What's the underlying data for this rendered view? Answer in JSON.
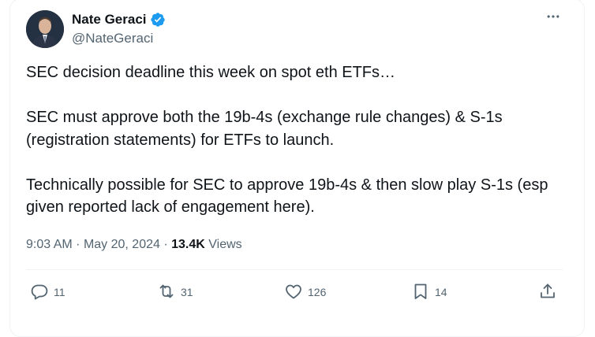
{
  "author": {
    "name": "Nate Geraci",
    "handle": "@NateGeraci"
  },
  "tweet": {
    "text": "SEC decision deadline this week on spot eth ETFs…\n\nSEC must approve both the 19b-4s (exchange rule changes) & S-1s (registration statements) for ETFs to launch.\n\nTechnically possible for SEC to approve 19b-4s & then slow play S-1s (esp given reported lack of engagement here).",
    "time": "9:03 AM",
    "separator": "·",
    "date": "May 20, 2024",
    "views_count": "13.4K",
    "views_label": "Views"
  },
  "actions": {
    "replies": "11",
    "reposts": "31",
    "likes": "126",
    "bookmarks": "14"
  },
  "icons": {
    "more": "more-horizontal-icon",
    "verified": "verified-badge-icon",
    "reply": "reply-bubble-icon",
    "repost": "repost-icon",
    "like": "heart-icon",
    "bookmark": "bookmark-icon",
    "share": "share-upload-icon"
  },
  "colors": {
    "verified": "#1d9bf0",
    "text": "#0f1419",
    "secondary": "#536471",
    "border": "#eff3f4"
  }
}
